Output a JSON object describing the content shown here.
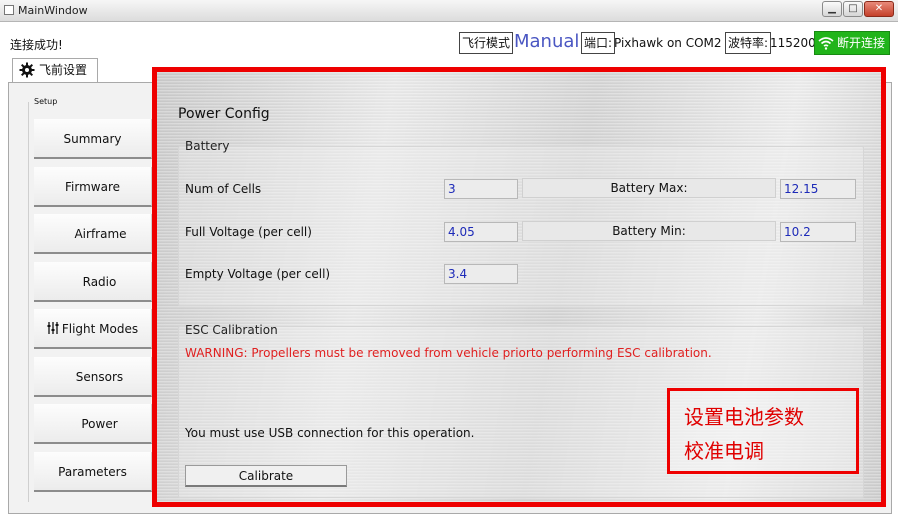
{
  "window": {
    "title": "MainWindow"
  },
  "status": {
    "connection": "连接成功!",
    "flight_mode_label": "飞行模式",
    "flight_mode_value": "Manual",
    "port_label": "端口:",
    "port_value": "Pixhawk on COM2",
    "baud_label": "波特率:",
    "baud_value": "115200",
    "disconnect_label": "断开连接"
  },
  "tab": {
    "label": "飞前设置"
  },
  "sidebar": {
    "group_label": "Setup",
    "items": [
      {
        "label": "Summary"
      },
      {
        "label": "Firmware"
      },
      {
        "label": "Airframe"
      },
      {
        "label": "Radio"
      },
      {
        "label": "Flight Modes"
      },
      {
        "label": "Sensors"
      },
      {
        "label": "Power"
      },
      {
        "label": "Parameters"
      }
    ]
  },
  "power": {
    "title": "Power Config",
    "battery": {
      "title": "Battery",
      "num_cells_label": "Num of Cells",
      "num_cells_value": "3",
      "full_voltage_label": "Full Voltage (per cell)",
      "full_voltage_value": "4.05",
      "empty_voltage_label": "Empty Voltage (per cell)",
      "empty_voltage_value": "3.4",
      "battery_max_label": "Battery Max:",
      "battery_max_value": "12.15",
      "battery_min_label": "Battery Min:",
      "battery_min_value": "10.2"
    },
    "esc": {
      "title": "ESC Calibration",
      "warning": "WARNING: Propellers must be removed from vehicle priorto performing ESC calibration.",
      "usb_note": "You must use USB connection for this operation.",
      "calibrate_label": "Calibrate"
    }
  },
  "annotation": {
    "line1": "设置电池参数",
    "line2": "校准电调"
  },
  "colors": {
    "highlight": "#ee0000",
    "mode_text": "#4a56c2",
    "disconnect_bg": "#21b41a",
    "value_text": "#1d2ab8",
    "warning_text": "#e02020"
  }
}
